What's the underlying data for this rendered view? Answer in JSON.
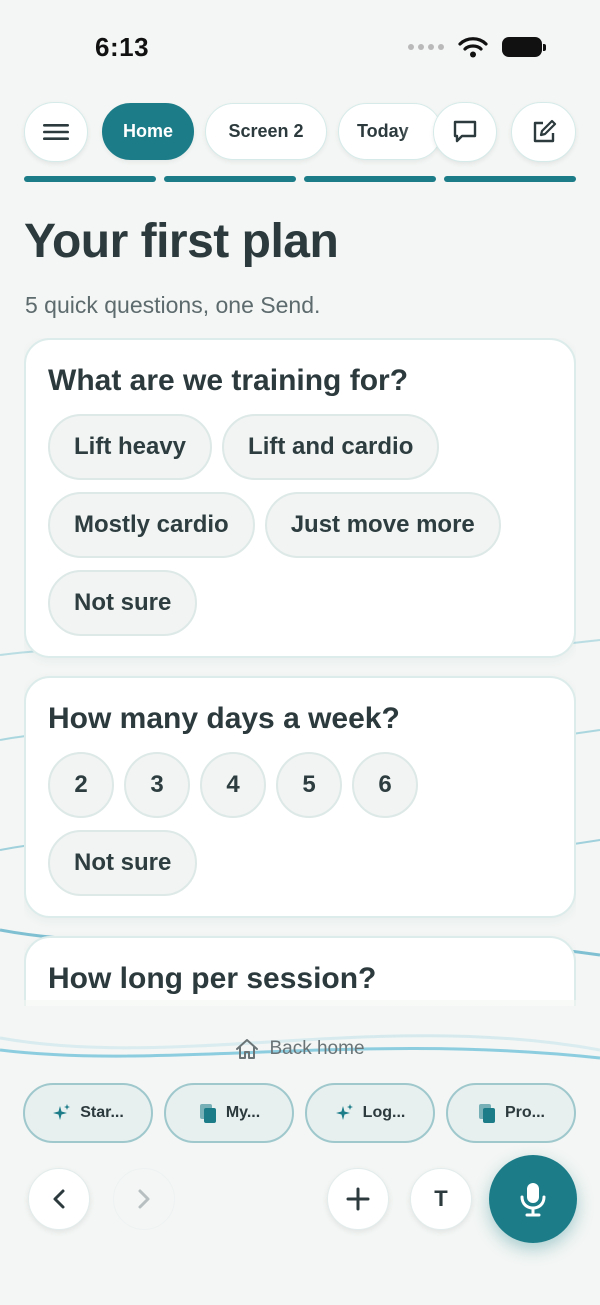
{
  "status_bar": {
    "time": "6:13"
  },
  "nav": {
    "menu_icon": "menu-icon",
    "tabs": [
      {
        "label": "Home",
        "active": true
      },
      {
        "label": "Screen 2",
        "active": false
      },
      {
        "label": "Today",
        "active": false
      }
    ],
    "chat_icon": "chat-icon",
    "edit_icon": "edit-icon"
  },
  "progress_steps": 4,
  "page": {
    "title": "Your first plan",
    "subtitle": "5 quick questions, one Send."
  },
  "questions": [
    {
      "title": "What are we training for?",
      "options": [
        "Lift heavy",
        "Lift and cardio",
        "Mostly cardio",
        "Just move more",
        "Not sure"
      ]
    },
    {
      "title": "How many days a week?",
      "options": [
        "2",
        "3",
        "4",
        "5",
        "6",
        "Not sure"
      ]
    },
    {
      "title": "How long per session?",
      "options": []
    }
  ],
  "back_home": {
    "label": "Back home",
    "icon": "home-icon"
  },
  "shortcuts": [
    {
      "label": "Star...",
      "icon": "sparkle-icon"
    },
    {
      "label": "My...",
      "icon": "copy-icon"
    },
    {
      "label": "Log...",
      "icon": "sparkle-icon"
    },
    {
      "label": "Pro...",
      "icon": "copy-icon"
    }
  ],
  "toolbar": {
    "back_icon": "chevron-left-icon",
    "forward_icon": "chevron-right-icon",
    "add_icon": "plus-icon",
    "text_label": "T",
    "mic_icon": "microphone-icon"
  },
  "colors": {
    "accent": "#1c7d89",
    "background": "#f3f6f4",
    "text": "#2c3a3d"
  }
}
